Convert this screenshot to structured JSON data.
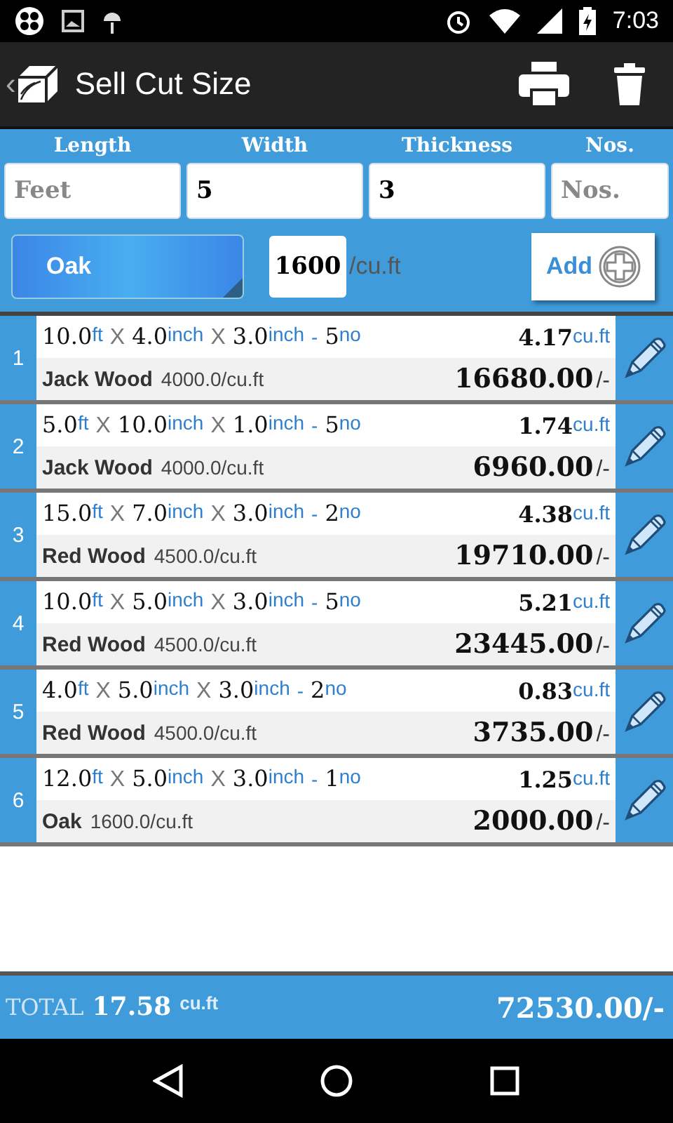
{
  "status_bar": {
    "time": "7:03"
  },
  "app_bar": {
    "back": "‹",
    "title": "Sell Cut Size"
  },
  "form": {
    "labels": [
      "Length",
      "Width",
      "Thickness",
      "Nos."
    ],
    "fields": [
      {
        "placeholder": "Feet"
      },
      {
        "value": "5"
      },
      {
        "value": "3"
      },
      {
        "placeholder": "Nos."
      }
    ],
    "wood": "Oak",
    "price": "1600",
    "price_unit": "/cu.ft",
    "add_label": "Add"
  },
  "rows": [
    {
      "number": "1",
      "dims": [
        {
          "value": "10.0",
          "unit": "ft"
        },
        {
          "sep": "X",
          "value": "4.0",
          "unit": "inch"
        },
        {
          "sep": "X",
          "value": "3.0",
          "unit": "inch"
        }
      ],
      "dash": "-",
      "count": "5",
      "count_unit": "no",
      "volume": "4.17",
      "volume_unit": "cu.ft",
      "wood": "Jack Wood",
      "rate": "4000.0/cu.ft",
      "amount": "16680.00",
      "suffix": "/-"
    },
    {
      "number": "2",
      "dims": [
        {
          "value": "5.0",
          "unit": "ft"
        },
        {
          "sep": "X",
          "value": "10.0",
          "unit": "inch"
        },
        {
          "sep": "X",
          "value": "1.0",
          "unit": "inch"
        }
      ],
      "dash": "-",
      "count": "5",
      "count_unit": "no",
      "volume": "1.74",
      "volume_unit": "cu.ft",
      "wood": "Jack Wood",
      "rate": "4000.0/cu.ft",
      "amount": "6960.00",
      "suffix": "/-"
    },
    {
      "number": "3",
      "dims": [
        {
          "value": "15.0",
          "unit": "ft"
        },
        {
          "sep": "X",
          "value": "7.0",
          "unit": "inch"
        },
        {
          "sep": "X",
          "value": "3.0",
          "unit": "inch"
        }
      ],
      "dash": "-",
      "count": "2",
      "count_unit": "no",
      "volume": "4.38",
      "volume_unit": "cu.ft",
      "wood": "Red Wood",
      "rate": "4500.0/cu.ft",
      "amount": "19710.00",
      "suffix": "/-"
    },
    {
      "number": "4",
      "dims": [
        {
          "value": "10.0",
          "unit": "ft"
        },
        {
          "sep": "X",
          "value": "5.0",
          "unit": "inch"
        },
        {
          "sep": "X",
          "value": "3.0",
          "unit": "inch"
        }
      ],
      "dash": "-",
      "count": "5",
      "count_unit": "no",
      "volume": "5.21",
      "volume_unit": "cu.ft",
      "wood": "Red Wood",
      "rate": "4500.0/cu.ft",
      "amount": "23445.00",
      "suffix": "/-"
    },
    {
      "number": "5",
      "dims": [
        {
          "value": "4.0",
          "unit": "ft"
        },
        {
          "sep": "X",
          "value": "5.0",
          "unit": "inch"
        },
        {
          "sep": "X",
          "value": "3.0",
          "unit": "inch"
        }
      ],
      "dash": "-",
      "count": "2",
      "count_unit": "no",
      "volume": "0.83",
      "volume_unit": "cu.ft",
      "wood": "Red Wood",
      "rate": "4500.0/cu.ft",
      "amount": "3735.00",
      "suffix": "/-"
    },
    {
      "number": "6",
      "dims": [
        {
          "value": "12.0",
          "unit": "ft"
        },
        {
          "sep": "X",
          "value": "5.0",
          "unit": "inch"
        },
        {
          "sep": "X",
          "value": "3.0",
          "unit": "inch"
        }
      ],
      "dash": "-",
      "count": "1",
      "count_unit": "no",
      "volume": "1.25",
      "volume_unit": "cu.ft",
      "wood": "Oak",
      "rate": "1600.0/cu.ft",
      "amount": "2000.00",
      "suffix": "/-"
    }
  ],
  "total": {
    "label": "TOTAL",
    "volume": "17.58",
    "unit": "cu.ft",
    "amount": "72530.00/-"
  }
}
